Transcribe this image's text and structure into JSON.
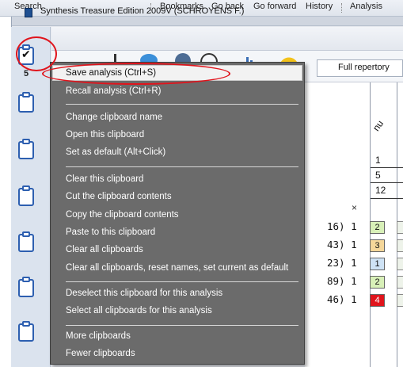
{
  "toolbar": {
    "search": "Search",
    "bookmarks": "Bookmarks",
    "go_back": "Go back",
    "go_forward": "Go forward",
    "history": "History",
    "analysis": "Analysis"
  },
  "window": {
    "title": "Synthesis Treasure Edition 2009V (SCHROYENS F.)",
    "repertory_select": "Full repertory"
  },
  "clipboards": {
    "selected_number": "5"
  },
  "context_menu": {
    "items": [
      "Save analysis (Ctrl+S)",
      "Recall analysis (Ctrl+R)",
      "Change clipboard name",
      "Open this clipboard",
      "Set as default (Alt+Click)",
      "Clear this clipboard",
      "Cut the clipboard contents",
      "Copy the clipboard contents",
      "Paste to this clipboard",
      "Clear all clipboards",
      "Clear all clipboards, reset names, set current as default",
      "Deselect this clipboard for this analysis",
      "Select all clipboards for this analysis",
      "More clipboards",
      "Fewer clipboards"
    ]
  },
  "analysis_grid": {
    "column_header": "nu",
    "header_values": [
      "1",
      "5",
      "12"
    ],
    "close_symbol": "×",
    "rows": [
      {
        "label": "16) 1",
        "value": "2",
        "color": "#d8f0b8"
      },
      {
        "label": "43) 1",
        "value": "3",
        "color": "#f5d79a"
      },
      {
        "label": "23) 1",
        "value": "1",
        "color": "#cfe3f5"
      },
      {
        "label": "89) 1",
        "value": "2",
        "color": "#d8f0b8"
      },
      {
        "label": "46) 1",
        "value": "4",
        "color": "#e0141c"
      }
    ]
  },
  "colors": {
    "annotation_red": "#e0141c",
    "menu_background": "#6b6b6b",
    "clipboard_blue": "#2d5fb0"
  }
}
